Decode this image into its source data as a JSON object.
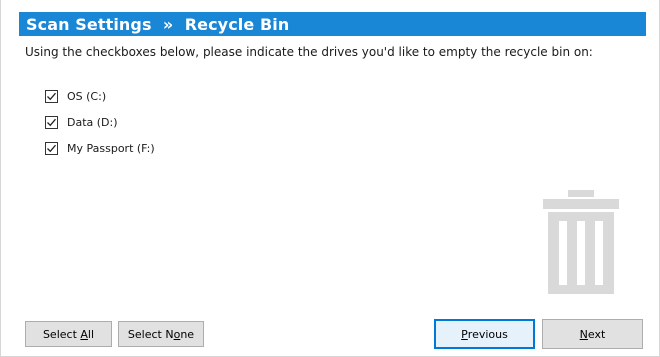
{
  "header": {
    "title": "Scan Settings  »  Recycle Bin"
  },
  "instruction": "Using the checkboxes below, please indicate the drives you'd like to empty the recycle bin on:",
  "drives": [
    {
      "label": "OS (C:)",
      "checked": true
    },
    {
      "label": "Data (D:)",
      "checked": true
    },
    {
      "label": "My Passport (F:)",
      "checked": true
    }
  ],
  "icons": {
    "trash": "trash-icon",
    "check": "checkmark-icon"
  },
  "buttons": {
    "select_all_pre": "Select ",
    "select_all_key": "A",
    "select_all_post": "ll",
    "select_none_pre": "Select N",
    "select_none_key": "o",
    "select_none_post": "ne",
    "previous_key": "P",
    "previous_post": "revious",
    "next_key": "N",
    "next_post": "ext"
  },
  "colors": {
    "header_bg": "#1a86d6",
    "header_text": "#ffffff",
    "trash_icon": "#d9d9d9",
    "default_button_border": "#0078d7"
  }
}
